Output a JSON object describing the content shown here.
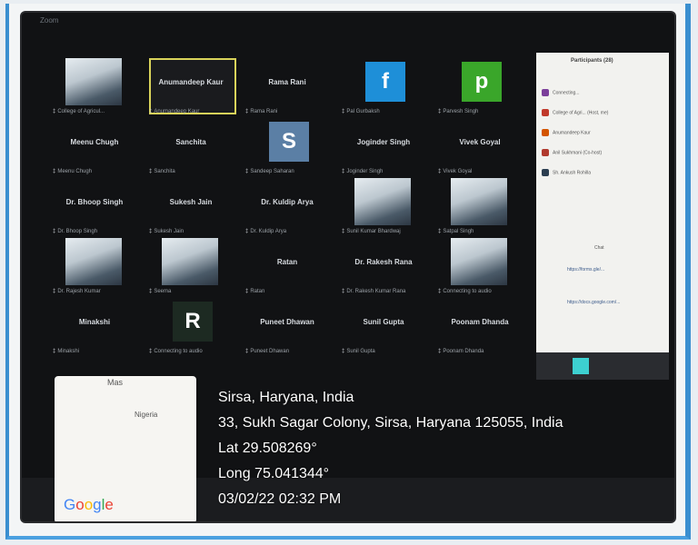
{
  "window": {
    "title": "Zoom"
  },
  "participants": [
    {
      "name": "",
      "label": "College of Agricul...",
      "kind": "video"
    },
    {
      "name": "Anumandeep Kaur",
      "label": "Anumandeep Kaur",
      "kind": "active"
    },
    {
      "name": "Rama Rani",
      "label": "Rama Rani",
      "kind": "name"
    },
    {
      "name": "",
      "label": "Pal Gurbaksh",
      "kind": "letter",
      "letter": "f",
      "color": "#1e8fd8"
    },
    {
      "name": "",
      "label": "Parvesh Singh",
      "kind": "letter",
      "letter": "p",
      "color": "#3aa62a"
    },
    {
      "name": "Meenu Chugh",
      "label": "Meenu Chugh",
      "kind": "name"
    },
    {
      "name": "Sanchita",
      "label": "Sanchita",
      "kind": "name"
    },
    {
      "name": "",
      "label": "Sandeep Saharan",
      "kind": "letter",
      "letter": "S",
      "color": "#5b7fa5"
    },
    {
      "name": "Joginder Singh",
      "label": "Joginder Singh",
      "kind": "name"
    },
    {
      "name": "Vivek Goyal",
      "label": "Vivek Goyal",
      "kind": "name"
    },
    {
      "name": "Dr. Bhoop Singh",
      "label": "Dr. Bhoop Singh",
      "kind": "name"
    },
    {
      "name": "Sukesh Jain",
      "label": "Sukesh Jain",
      "kind": "name"
    },
    {
      "name": "Dr. Kuldip Arya",
      "label": "Dr. Kuldip Arya",
      "kind": "name"
    },
    {
      "name": "",
      "label": "Sunil Kumar Bhardwaj",
      "kind": "video"
    },
    {
      "name": "",
      "label": "Satpal Singh",
      "kind": "video"
    },
    {
      "name": "",
      "label": "Dr. Rajesh Kumar",
      "kind": "video"
    },
    {
      "name": "",
      "label": "Seema",
      "kind": "video"
    },
    {
      "name": "Ratan",
      "label": "Ratan",
      "kind": "name"
    },
    {
      "name": "Dr. Rakesh Rana",
      "label": "Dr. Rakesh Kumar Rana",
      "kind": "name"
    },
    {
      "name": "",
      "label": "Connecting to audio",
      "kind": "video"
    },
    {
      "name": "Minakshi",
      "label": "Minakshi",
      "kind": "name"
    },
    {
      "name": "",
      "label": "Connecting to audio",
      "kind": "letter",
      "letter": "R",
      "color": "#1d2a22"
    },
    {
      "name": "Puneet Dhawan",
      "label": "Puneet Dhawan",
      "kind": "name"
    },
    {
      "name": "Sunil Gupta",
      "label": "Sunil Gupta",
      "kind": "name"
    },
    {
      "name": "Poonam Dhanda",
      "label": "Poonam Dhanda",
      "kind": "name"
    }
  ],
  "sidepanel": {
    "title": "Participants (28)",
    "rows": [
      "Connecting...",
      "College of Agri... (Host, me)",
      "Anumandeep Kaur",
      "Anil Sukhmani (Co-host)",
      "Sh. Ankush Rohilla"
    ],
    "tab_chat": "Chat",
    "chat_lines": [
      "https://forms.gle/...",
      "https://docs.google.com/..."
    ]
  },
  "map": {
    "top_label": "Mas",
    "region_label": "Nigeria",
    "google": [
      "G",
      "o",
      "o",
      "g",
      "l",
      "e"
    ]
  },
  "geotag": {
    "place": "Sirsa, Haryana, India",
    "address": "33, Sukh Sagar Colony, Sirsa, Haryana 125055, India",
    "lat": "Lat 29.508269°",
    "long": "Long 75.041344°",
    "datetime": "03/02/22 02:32 PM"
  }
}
